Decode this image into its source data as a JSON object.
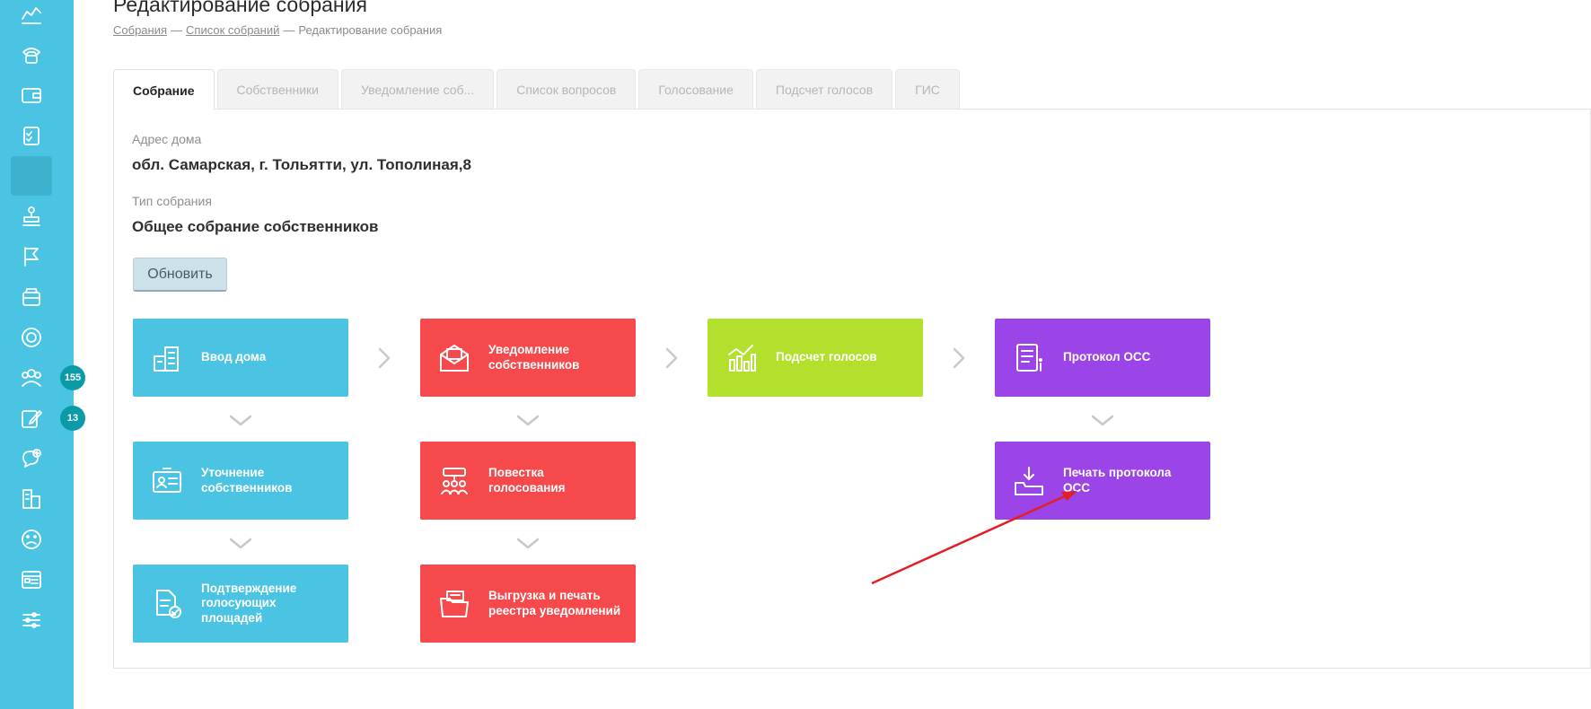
{
  "page": {
    "title": "Редактирование собрания",
    "breadcrumb": [
      "Собрания",
      "Список собраний",
      "Редактирование собрания"
    ],
    "breadcrumb_sep": "—"
  },
  "sidebar": {
    "items": [
      {
        "icon": "chart-icon"
      },
      {
        "icon": "phone-icon"
      },
      {
        "icon": "wallet-icon"
      },
      {
        "icon": "checklist-icon"
      },
      {
        "icon": "blank-active-icon"
      },
      {
        "icon": "stamp-icon"
      },
      {
        "icon": "flag-icon"
      },
      {
        "icon": "archive-icon"
      },
      {
        "icon": "coin-icon"
      },
      {
        "icon": "people-icon",
        "badge": "155"
      },
      {
        "icon": "edit-icon",
        "badge": "13"
      },
      {
        "icon": "chat-add-icon"
      },
      {
        "icon": "buildings-icon"
      },
      {
        "icon": "sad-face-icon"
      },
      {
        "icon": "dashboard-icon"
      },
      {
        "icon": "sliders-icon"
      }
    ]
  },
  "tabs": [
    "Собрание",
    "Собственники",
    "Уведомление соб...",
    "Список вопросов",
    "Голосование",
    "Подсчет голосов",
    "ГИС"
  ],
  "fields": {
    "address_label": "Адрес дома",
    "address_value": "обл. Самарская, г. Тольятти, ул. Тополиная,8",
    "type_label": "Тип собрания",
    "type_value": "Общее собрание собственников"
  },
  "update_button": "Обновить",
  "workflow": {
    "house_input": "Ввод дома",
    "owners_clarify": "Уточнение собственников",
    "voting_area_confirm": "Подтверждение голосующих площадей",
    "owners_notify": "Уведомление собственников",
    "voting_agenda": "Повестка голосования",
    "registry_export": "Выгрузка и печать реестра уведомлений",
    "vote_count": "Подсчет голосов",
    "protocol": "Протокол ОСС",
    "protocol_print": "Печать протокола ОСС"
  },
  "colors": {
    "sidebar": "#4ac4e2",
    "blue": "#4ac4e2",
    "red": "#f5494b",
    "green": "#b2e02c",
    "purple": "#9b44e7",
    "badge": "#0a9aa8",
    "annotation_arrow": "#e31e24"
  }
}
